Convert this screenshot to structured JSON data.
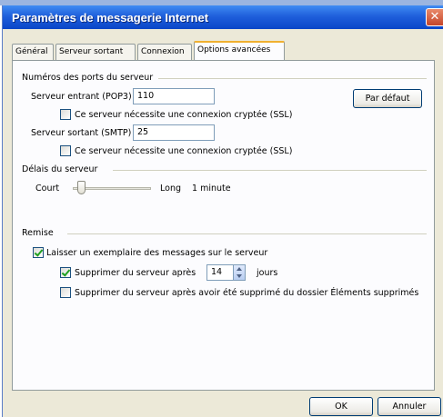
{
  "window": {
    "title": "Paramètres de messagerie Internet",
    "close_glyph": "✕"
  },
  "tabs": [
    {
      "label": "Général",
      "active": false
    },
    {
      "label": "Serveur sortant",
      "active": false
    },
    {
      "label": "Connexion",
      "active": false
    },
    {
      "label": "Options avancées",
      "active": true
    }
  ],
  "ports": {
    "section_label": "Numéros des ports du serveur",
    "incoming_label": "Serveur entrant (POP3) :",
    "incoming_value": "110",
    "incoming_ssl_label": "Ce serveur nécessite une connexion cryptée (SSL)",
    "incoming_ssl_checked": false,
    "outgoing_label": "Serveur sortant (SMTP) :",
    "outgoing_value": "25",
    "outgoing_ssl_label": "Ce serveur nécessite une connexion cryptée (SSL)",
    "outgoing_ssl_checked": false,
    "default_button": "Par défaut"
  },
  "timeout": {
    "section_label": "Délais du serveur",
    "short_label": "Court",
    "long_label": "Long",
    "value_label": "1 minute",
    "slider_level": 0.1
  },
  "delivery": {
    "section_label": "Remise",
    "leave_copy_label": "Laisser un exemplaire des messages sur le serveur",
    "leave_copy_checked": true,
    "remove_after_label": "Supprimer du serveur après",
    "remove_after_checked": true,
    "days_value": "14",
    "days_unit": "jours",
    "remove_deleted_label": "Supprimer du serveur après avoir été supprimé du dossier Éléments supprimés",
    "remove_deleted_checked": false
  },
  "footer": {
    "ok_button": "OK",
    "cancel_button": "Annuler"
  }
}
